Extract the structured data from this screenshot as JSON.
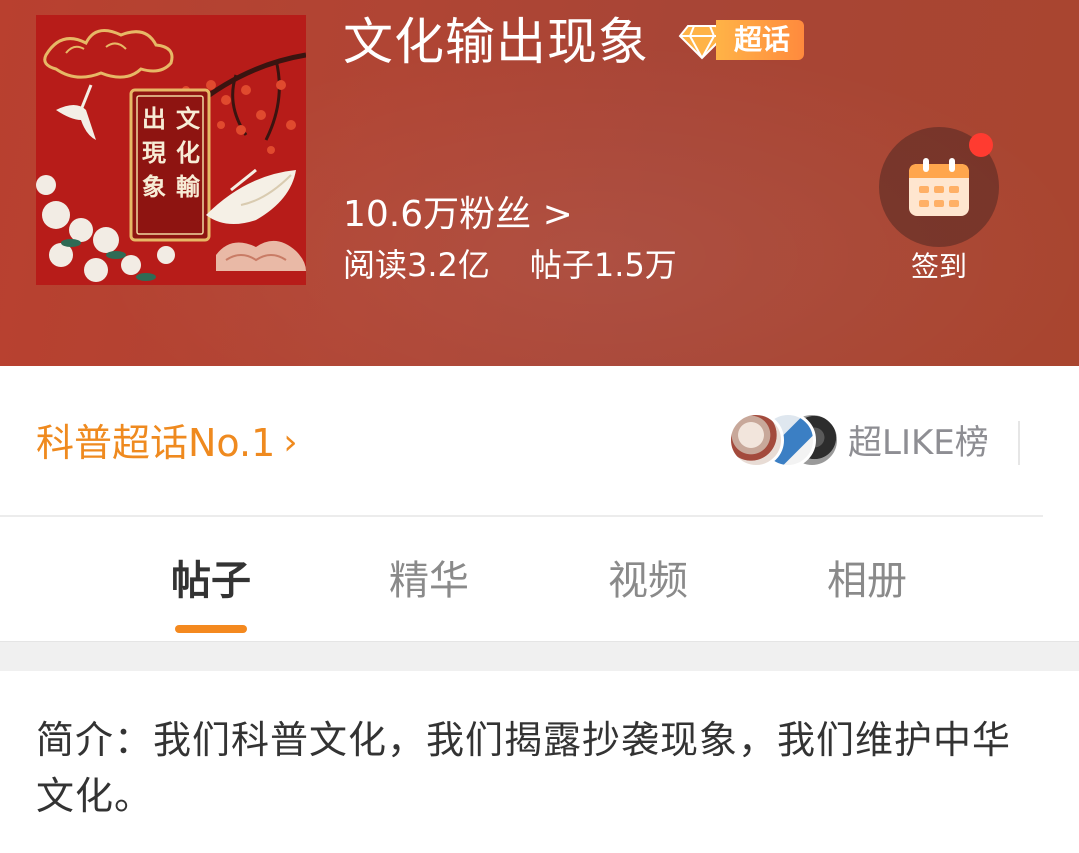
{
  "header": {
    "title": "文化输出现象",
    "badge_label": "超话",
    "cover_text": "文化輸出現象",
    "fans": "10.6万粉丝 >",
    "reads": "阅读3.2亿",
    "posts": "帖子1.5万",
    "checkin_label": "签到",
    "checkin_icon": "calendar-icon"
  },
  "rank": {
    "label": "科普超话No.1",
    "like_board": "超LIKE榜"
  },
  "tabs": [
    {
      "label": "帖子",
      "active": true
    },
    {
      "label": "精华",
      "active": false
    },
    {
      "label": "视频",
      "active": false
    },
    {
      "label": "相册",
      "active": false
    }
  ],
  "intro": "简介：我们科普文化，我们揭露抄袭现象，我们维护中华文化。",
  "colors": {
    "accent_orange": "#f4891f",
    "header_red": "#b04534",
    "notification_red": "#ff3b30"
  }
}
